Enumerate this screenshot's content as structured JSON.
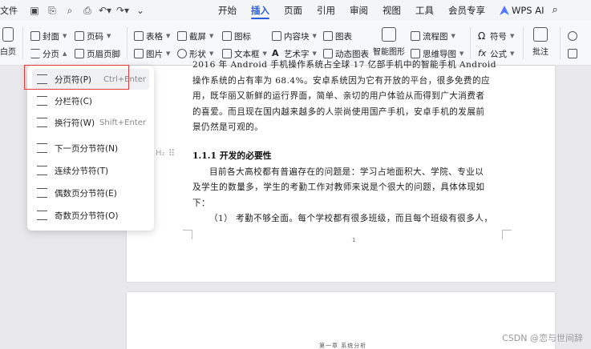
{
  "topbar": {
    "file_label": "文件",
    "menus": [
      "开始",
      "插入",
      "页面",
      "引用",
      "审阅",
      "视图",
      "工具",
      "会员专享"
    ],
    "active_menu": "插入",
    "wps_ai": "WPS AI"
  },
  "ribbon": {
    "blank_page": "白页",
    "cover": "封面",
    "page_break": "分页",
    "page_number": "页码",
    "header_footer": "页眉页脚",
    "table": "表格",
    "picture": "图片",
    "screenshot": "截屏",
    "shape": "形状",
    "icon": "图标",
    "textbox": "文本框",
    "content_control": "内容块",
    "art_text": "艺术字",
    "chart": "图表",
    "dynamic_chart": "动态图表",
    "smart_graphic": "智能图形",
    "flowchart": "流程图",
    "mindmap": "思维导图",
    "symbol": "符号",
    "formula": "公式",
    "comment": "批注"
  },
  "dropdown": {
    "items": [
      {
        "label": "分页符(P)",
        "shortcut": "Ctrl+Enter"
      },
      {
        "label": "分栏符(C)",
        "shortcut": ""
      },
      {
        "label": "换行符(W)",
        "shortcut": "Shift+Enter"
      },
      {
        "label": "下一页分节符(N)",
        "shortcut": ""
      },
      {
        "label": "连续分节符(T)",
        "shortcut": ""
      },
      {
        "label": "偶数页分节符(E)",
        "shortcut": ""
      },
      {
        "label": "奇数页分节符(O)",
        "shortcut": ""
      }
    ]
  },
  "document": {
    "line_top": "2016 年 Android 手机操作系统占全球 17 亿部手机中的智能手机 Android",
    "para1": [
      "操作系统的占有率为 68.4%。安卓系统因为它有开放的平台，很多免费的应",
      "用，既华丽又新鲜的运行界面，简单、亲切的用户体验从而得到广大消费者",
      "的喜爱。而且现在国内越来越多的人崇尚使用国产手机，安卓手机的发展前",
      "景仍然是可观的。"
    ],
    "heading_mark": "H₂",
    "heading": "1.1.1  开发的必要性",
    "para2": [
      "目前各大高校都有普遍存在的问题是：学习占地面积大、学院、专业以",
      "及学生的数量多，学生的考勤工作对教师来说是个很大的问题，具体体现如",
      "下：",
      "（1） 考勤不够全面。每个学校都有很多班级，而且每个班级有很多人，"
    ],
    "page_number": "1",
    "page2_footer": "第一章  系统分析"
  },
  "watermark": "CSDN @恋与世间辞"
}
